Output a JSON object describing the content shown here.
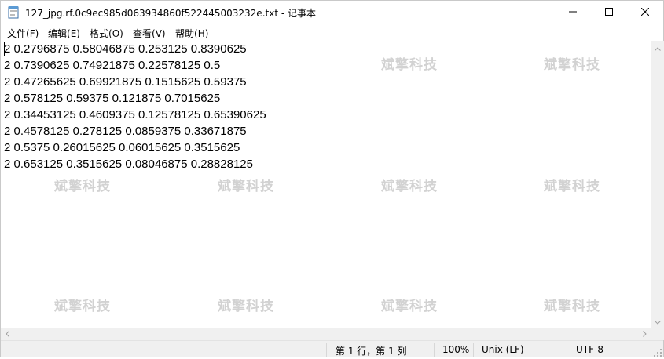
{
  "window": {
    "title": "127_jpg.rf.0c9ec985d063934860f522445003232e.txt - 记事本"
  },
  "menu": {
    "items": [
      {
        "text": "文件(",
        "key": "F",
        "close": ")"
      },
      {
        "text": "编辑(",
        "key": "E",
        "close": ")"
      },
      {
        "text": "格式(",
        "key": "O",
        "close": ")"
      },
      {
        "text": "查看(",
        "key": "V",
        "close": ")"
      },
      {
        "text": "帮助(",
        "key": "H",
        "close": ")"
      }
    ]
  },
  "editor": {
    "lines": [
      "2 0.2796875 0.58046875 0.253125 0.8390625",
      "2 0.7390625 0.74921875 0.22578125 0.5",
      "2 0.47265625 0.69921875 0.1515625 0.59375",
      "2 0.578125 0.59375 0.121875 0.7015625",
      "2 0.34453125 0.4609375 0.12578125 0.65390625",
      "2 0.4578125 0.278125 0.0859375 0.33671875",
      "2 0.5375 0.26015625 0.06015625 0.3515625",
      "2 0.653125 0.3515625 0.08046875 0.28828125"
    ],
    "watermark": "斌擎科技"
  },
  "status": {
    "position": "第 1 行，第 1 列",
    "zoom": "100%",
    "line_ending": "Unix (LF)",
    "encoding": "UTF-8"
  },
  "icons": {
    "app": "notepad-icon",
    "minimize": "minimize-icon",
    "maximize": "maximize-icon",
    "close": "close-icon"
  }
}
